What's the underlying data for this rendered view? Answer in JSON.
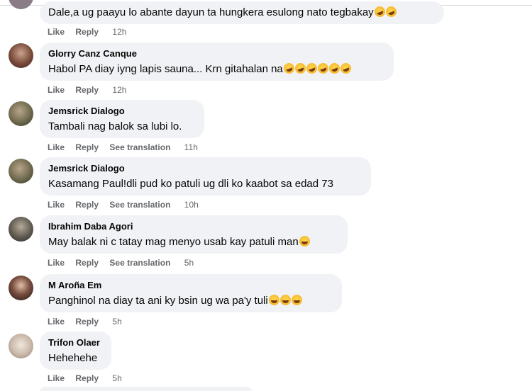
{
  "actions": {
    "like": "Like",
    "reply": "Reply",
    "see_translation": "See translation"
  },
  "comments": [
    {
      "author": "",
      "text": "Dale,a ug paayu lo abante dayun ta hungkera esulong nato tegbakay",
      "emojis": [
        "rofl",
        "rofl"
      ],
      "time": "12h",
      "translation": false
    },
    {
      "author": "Glorry Canz Canque",
      "text": "Habol PA diay iyng lapis sauna... Krn gitahalan na",
      "emojis": [
        "rofl",
        "rofl",
        "rofl",
        "rofl",
        "rofl",
        "rofl"
      ],
      "time": "12h",
      "translation": false
    },
    {
      "author": "Jemsrick Dialogo",
      "text": "Tambali nag balok sa lubi lo.",
      "emojis": [],
      "time": "11h",
      "translation": true
    },
    {
      "author": "Jemsrick Dialogo",
      "text": "Kasamang Paul!dli pud ko patuli ug dli ko kaabot sa edad 73",
      "emojis": [],
      "time": "10h",
      "translation": true
    },
    {
      "author": "Ibrahim Daba Agori",
      "text": "May balak ni c tatay mag menyo usab kay patuli man",
      "emojis": [
        "grin"
      ],
      "time": "5h",
      "translation": true
    },
    {
      "author": "M Aroña Em",
      "text": "Panghinol na diay ta ani ky bsin ug wa pa'y tuli",
      "emojis": [
        "laugh",
        "laugh",
        "laugh"
      ],
      "time": "5h",
      "translation": false
    },
    {
      "author": "Trifon Olaer",
      "text": "Hehehehe",
      "emojis": [],
      "time": "5h",
      "translation": false
    }
  ],
  "colors": {
    "bubble": "#f0f2f5",
    "secondary_text": "#65676b",
    "primary_text": "#050505"
  }
}
